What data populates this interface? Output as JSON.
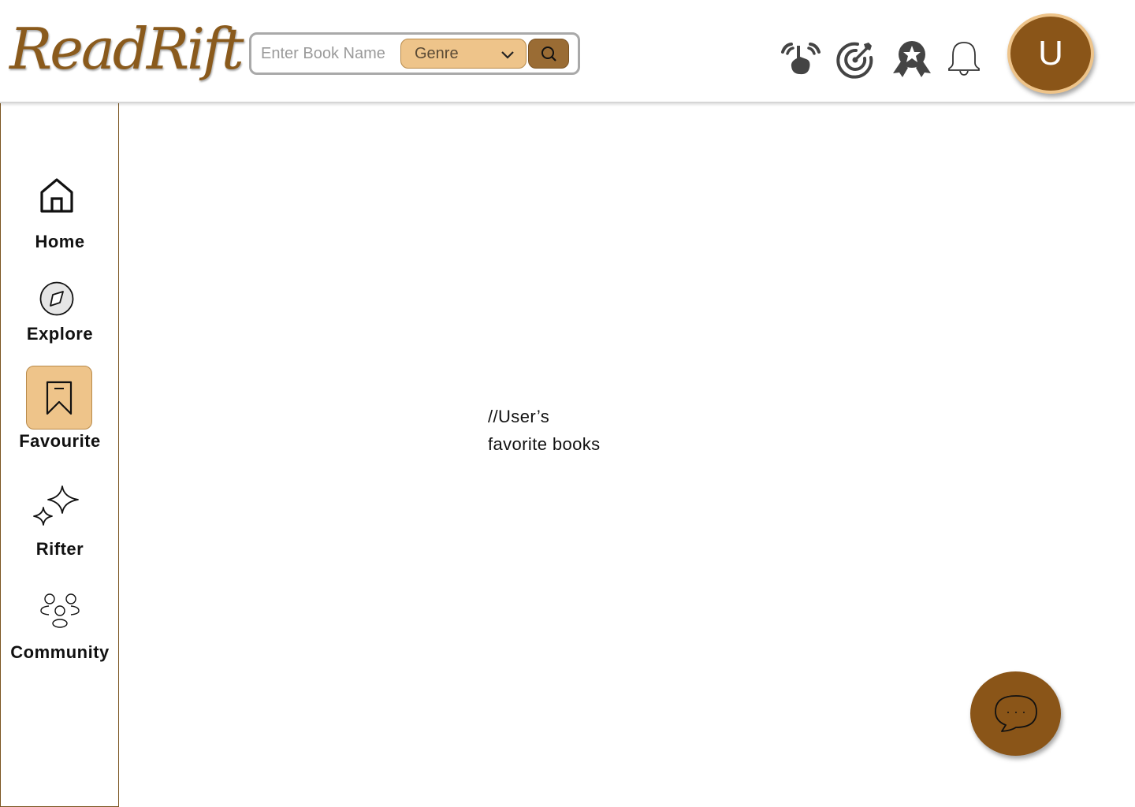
{
  "app": {
    "logo_text": "ReadRift"
  },
  "search": {
    "placeholder": "Enter Book Name",
    "value": "",
    "genre_label": "Genre"
  },
  "header_icons": [
    "streak-hand-icon",
    "target-goal-icon",
    "award-badge-icon",
    "bell-notification-icon"
  ],
  "user": {
    "avatar_initial": "U"
  },
  "sidebar": {
    "items": [
      {
        "label": "Home",
        "icon": "home-icon",
        "active": false
      },
      {
        "label": "Explore",
        "icon": "compass-icon",
        "active": false
      },
      {
        "label": "Favourite",
        "icon": "bookmark-icon",
        "active": true
      },
      {
        "label": "Rifter",
        "icon": "sparkle-icon",
        "active": false
      },
      {
        "label": "Community",
        "icon": "people-group-icon",
        "active": false
      }
    ]
  },
  "main": {
    "placeholder_line1": "//User’s",
    "placeholder_line2": "favorite books"
  },
  "chat": {
    "icon": "chat-bubble-icon"
  },
  "colors": {
    "brand_brown": "#8a5518",
    "accent_tan": "#eec48a",
    "search_button": "#9a6c34"
  }
}
